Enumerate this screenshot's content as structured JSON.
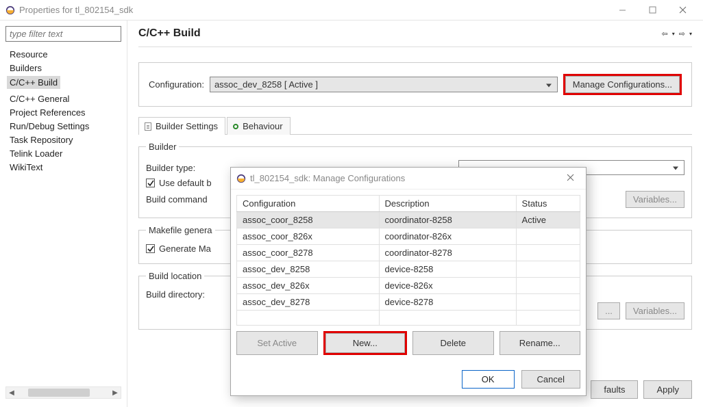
{
  "titlebar": {
    "title": "Properties for tl_802154_sdk"
  },
  "sidebar": {
    "filter_placeholder": "type filter text",
    "items": [
      {
        "label": "Resource"
      },
      {
        "label": "Builders"
      },
      {
        "label": "C/C++ Build",
        "selected": true
      },
      {
        "label": "C/C++ General"
      },
      {
        "label": "Project References"
      },
      {
        "label": "Run/Debug Settings"
      },
      {
        "label": "Task Repository"
      },
      {
        "label": "Telink Loader"
      },
      {
        "label": "WikiText"
      }
    ]
  },
  "page": {
    "title": "C/C++ Build",
    "config_label": "Configuration:",
    "config_value": "assoc_dev_8258  [ Active ]",
    "manage_btn": "Manage Configurations...",
    "tabs": {
      "builder": "Builder Settings",
      "behaviour": "Behaviour"
    },
    "builder": {
      "legend": "Builder",
      "type_label": "Builder type:",
      "use_default_label": "Use default b",
      "build_cmd_label": "Build command",
      "variables_btn": "Variables..."
    },
    "makefile": {
      "legend": "Makefile genera",
      "generate_label": "Generate Ma"
    },
    "buildloc": {
      "legend": "Build location",
      "dir_label": "Build directory:",
      "variables_btn": "Variables..."
    },
    "restore_btn": "faults",
    "apply_btn": "Apply"
  },
  "modal": {
    "title": "tl_802154_sdk: Manage Configurations",
    "columns": {
      "config": "Configuration",
      "desc": "Description",
      "status": "Status"
    },
    "rows": [
      {
        "config": "assoc_coor_8258",
        "desc": "coordinator-8258",
        "status": "Active",
        "selected": true
      },
      {
        "config": "assoc_coor_826x",
        "desc": "coordinator-826x",
        "status": ""
      },
      {
        "config": "assoc_coor_8278",
        "desc": "coordinator-8278",
        "status": ""
      },
      {
        "config": "assoc_dev_8258",
        "desc": "device-8258",
        "status": ""
      },
      {
        "config": "assoc_dev_826x",
        "desc": "device-826x",
        "status": ""
      },
      {
        "config": "assoc_dev_8278",
        "desc": "device-8278",
        "status": ""
      }
    ],
    "buttons": {
      "set_active": "Set Active",
      "new": "New...",
      "delete": "Delete",
      "rename": "Rename..."
    },
    "ok": "OK",
    "cancel": "Cancel"
  }
}
